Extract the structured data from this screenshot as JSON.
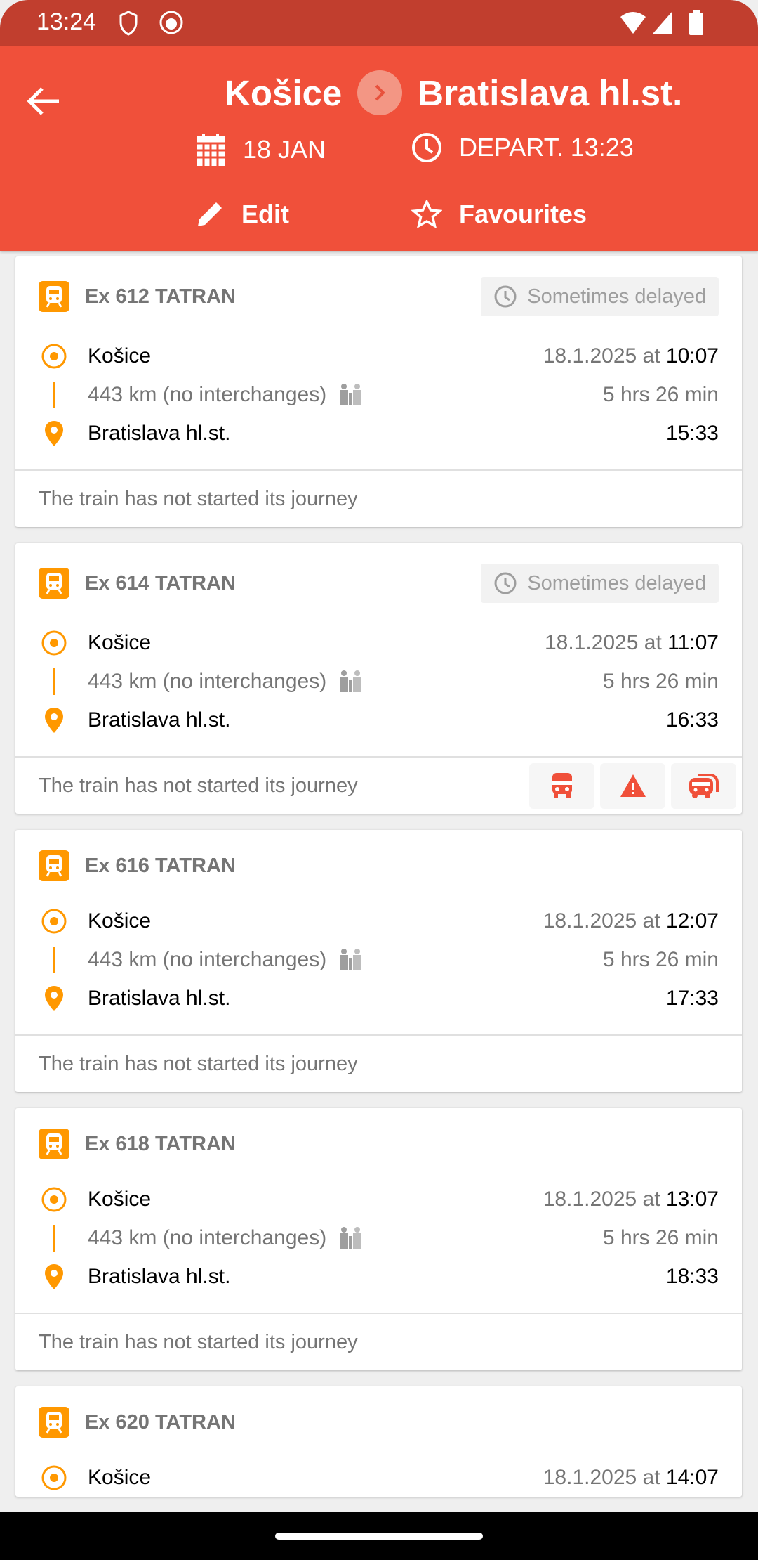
{
  "status_bar": {
    "time": "13:24"
  },
  "header": {
    "from": "Košice",
    "to": "Bratislava hl.st.",
    "date": "18 JAN",
    "depart": "DEPART. 13:23",
    "edit_label": "Edit",
    "favourites_label": "Favourites"
  },
  "colors": {
    "header": "#f0503a",
    "status_bar": "#c13e2e",
    "accent": "#ff9800"
  },
  "trains": [
    {
      "name": "Ex 612 TATRAN",
      "badge": "Sometimes delayed",
      "from": "Košice",
      "date": "18.1.2025 at",
      "dep": "10:07",
      "distance": "443 km (no interchanges)",
      "duration": "5 hrs 26 min",
      "to": "Bratislava hl.st.",
      "arr": "15:33",
      "status": "The train has not started its journey"
    },
    {
      "name": "Ex 614 TATRAN",
      "badge": "Sometimes delayed",
      "from": "Košice",
      "date": "18.1.2025 at",
      "dep": "11:07",
      "distance": "443 km (no interchanges)",
      "duration": "5 hrs 26 min",
      "to": "Bratislava hl.st.",
      "arr": "16:33",
      "status": "The train has not started its journey",
      "actions": [
        "bus-icon",
        "warning-icon",
        "replacement-bus-icon"
      ]
    },
    {
      "name": "Ex 616 TATRAN",
      "from": "Košice",
      "date": "18.1.2025 at",
      "dep": "12:07",
      "distance": "443 km (no interchanges)",
      "duration": "5 hrs 26 min",
      "to": "Bratislava hl.st.",
      "arr": "17:33",
      "status": "The train has not started its journey"
    },
    {
      "name": "Ex 618 TATRAN",
      "from": "Košice",
      "date": "18.1.2025 at",
      "dep": "13:07",
      "distance": "443 km (no interchanges)",
      "duration": "5 hrs 26 min",
      "to": "Bratislava hl.st.",
      "arr": "18:33",
      "status": "The train has not started its journey"
    },
    {
      "name": "Ex 620 TATRAN",
      "from": "Košice",
      "date": "18.1.2025 at",
      "dep": "14:07"
    }
  ]
}
